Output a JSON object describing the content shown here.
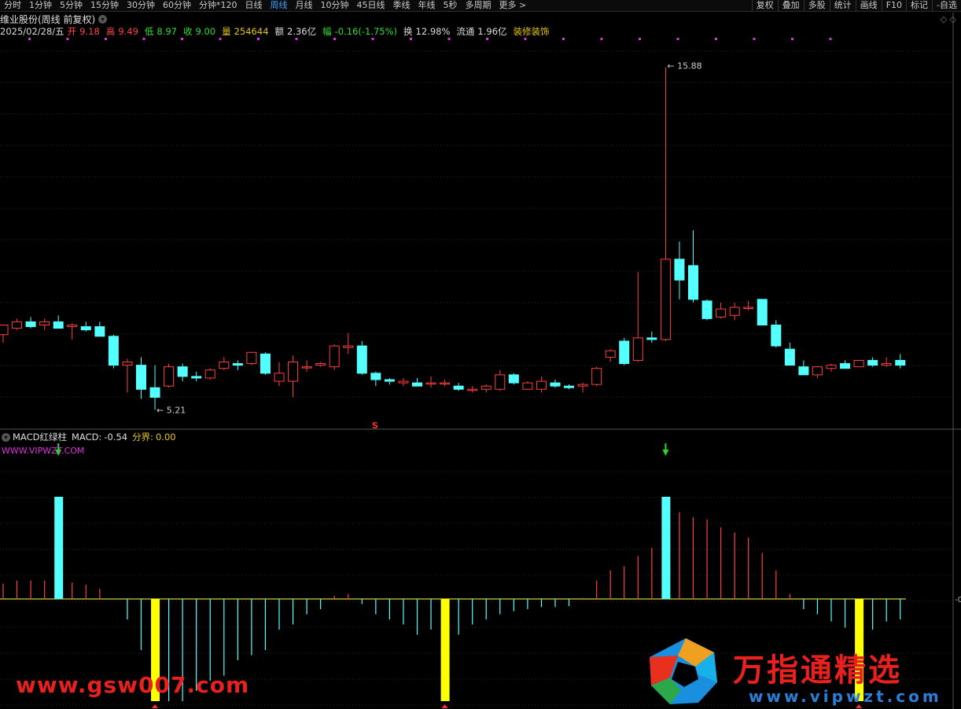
{
  "toolbar": {
    "tabs": [
      "分时",
      "1分钟",
      "5分钟",
      "15分钟",
      "30分钟",
      "60分钟",
      "分钟*120",
      "日线",
      "周线",
      "月线",
      "10分钟",
      "45日线",
      "季线",
      "年线",
      "5秒",
      "多周期",
      "更多 >"
    ],
    "active_tab": "周线",
    "right_buttons": [
      "复权",
      "叠加",
      "多股",
      "统计",
      "画线",
      "F10",
      "标记",
      "-自选"
    ]
  },
  "stock": {
    "title": "维业股份(周线 前复权)",
    "date": "2025/02/28/五",
    "open_label": "开",
    "open": "9.18",
    "high_label": "高",
    "high": "9.49",
    "low_label": "低",
    "low": "8.97",
    "close_label": "收",
    "close": "9.00",
    "volume_label": "量",
    "volume": "254644",
    "amount_label": "额",
    "amount": "2.36亿",
    "change_label": "幅",
    "change": "-0.16(-1.75%)",
    "turnover_label": "换",
    "turnover": "12.98%",
    "float_label": "流通",
    "float": "1.96亿",
    "sector": "装修装饰"
  },
  "price_annotations": {
    "high": "15.88",
    "low": "5.21",
    "signal": "S"
  },
  "macd_panel": {
    "title": "MACD红绿柱",
    "macd_label": "MACD:",
    "macd_value": "-0.54",
    "boundary_label": "分界:",
    "boundary_value": "0.00",
    "watermark": "WWW.VIPWZT.COM",
    "axis_label": "-0"
  },
  "branding": {
    "left_url": "www.gsw007.com",
    "logo_title": "万指通精选",
    "logo_url": "www.vipwzt.com"
  },
  "colors": {
    "up": "#ff4040",
    "down": "#54ffff",
    "macd_pos": "#ff4040",
    "macd_neg": "#54ffff",
    "highlight_yellow": "#ffff00",
    "zero_line": "#ffff55",
    "grid": "#2a2a2a",
    "dots": "#dd33dd"
  },
  "chart_data": {
    "type": "candlestick",
    "price_range": [
      5.0,
      16.5
    ],
    "candles": [
      {
        "o": 7.55,
        "h": 7.85,
        "l": 7.3,
        "c": 7.85
      },
      {
        "o": 7.75,
        "h": 8.05,
        "l": 7.7,
        "c": 7.95
      },
      {
        "o": 7.95,
        "h": 8.1,
        "l": 7.75,
        "c": 7.8
      },
      {
        "o": 7.85,
        "h": 8.05,
        "l": 7.7,
        "c": 7.95
      },
      {
        "o": 7.95,
        "h": 8.15,
        "l": 7.75,
        "c": 7.75
      },
      {
        "o": 7.8,
        "h": 7.9,
        "l": 7.4,
        "c": 7.85
      },
      {
        "o": 7.8,
        "h": 7.95,
        "l": 7.65,
        "c": 7.7
      },
      {
        "o": 7.8,
        "h": 7.95,
        "l": 7.5,
        "c": 7.5
      },
      {
        "o": 7.5,
        "h": 7.55,
        "l": 6.5,
        "c": 6.6
      },
      {
        "o": 6.6,
        "h": 6.8,
        "l": 5.75,
        "c": 6.7
      },
      {
        "o": 6.6,
        "h": 6.85,
        "l": 5.55,
        "c": 5.85
      },
      {
        "o": 5.9,
        "h": 6.6,
        "l": 5.21,
        "c": 5.6
      },
      {
        "o": 5.95,
        "h": 6.65,
        "l": 5.9,
        "c": 6.55
      },
      {
        "o": 6.55,
        "h": 6.65,
        "l": 6.1,
        "c": 6.25
      },
      {
        "o": 6.25,
        "h": 6.4,
        "l": 6.1,
        "c": 6.2
      },
      {
        "o": 6.2,
        "h": 6.5,
        "l": 6.15,
        "c": 6.45
      },
      {
        "o": 6.5,
        "h": 6.85,
        "l": 6.45,
        "c": 6.7
      },
      {
        "o": 6.65,
        "h": 6.75,
        "l": 6.45,
        "c": 6.6
      },
      {
        "o": 6.65,
        "h": 7.0,
        "l": 6.6,
        "c": 7.0
      },
      {
        "o": 6.95,
        "h": 7.0,
        "l": 6.3,
        "c": 6.35
      },
      {
        "o": 6.1,
        "h": 6.7,
        "l": 5.95,
        "c": 6.35
      },
      {
        "o": 6.1,
        "h": 6.9,
        "l": 5.6,
        "c": 6.7
      },
      {
        "o": 6.55,
        "h": 6.75,
        "l": 6.4,
        "c": 6.55
      },
      {
        "o": 6.6,
        "h": 6.7,
        "l": 6.55,
        "c": 6.65
      },
      {
        "o": 6.55,
        "h": 7.25,
        "l": 6.45,
        "c": 7.2
      },
      {
        "o": 7.15,
        "h": 7.6,
        "l": 6.95,
        "c": 7.2
      },
      {
        "o": 7.2,
        "h": 7.35,
        "l": 6.3,
        "c": 6.35
      },
      {
        "o": 6.35,
        "h": 6.4,
        "l": 5.95,
        "c": 6.15
      },
      {
        "o": 6.15,
        "h": 6.2,
        "l": 6.0,
        "c": 6.1
      },
      {
        "o": 6.05,
        "h": 6.2,
        "l": 5.95,
        "c": 6.1
      },
      {
        "o": 6.05,
        "h": 6.2,
        "l": 5.95,
        "c": 5.95
      },
      {
        "o": 6.05,
        "h": 6.25,
        "l": 5.9,
        "c": 6.05
      },
      {
        "o": 6.05,
        "h": 6.15,
        "l": 5.95,
        "c": 6.05
      },
      {
        "o": 5.95,
        "h": 6.05,
        "l": 5.8,
        "c": 5.85
      },
      {
        "o": 5.85,
        "h": 5.95,
        "l": 5.75,
        "c": 5.85
      },
      {
        "o": 5.85,
        "h": 6.0,
        "l": 5.75,
        "c": 5.95
      },
      {
        "o": 5.85,
        "h": 6.45,
        "l": 5.8,
        "c": 6.3
      },
      {
        "o": 6.3,
        "h": 6.35,
        "l": 6.0,
        "c": 6.05
      },
      {
        "o": 5.85,
        "h": 6.1,
        "l": 5.85,
        "c": 6.05
      },
      {
        "o": 5.85,
        "h": 6.25,
        "l": 5.75,
        "c": 6.1
      },
      {
        "o": 6.05,
        "h": 6.15,
        "l": 5.9,
        "c": 5.95
      },
      {
        "o": 5.95,
        "h": 6.0,
        "l": 5.85,
        "c": 5.9
      },
      {
        "o": 5.95,
        "h": 6.05,
        "l": 5.75,
        "c": 6.0
      },
      {
        "o": 6.0,
        "h": 6.55,
        "l": 5.95,
        "c": 6.5
      },
      {
        "o": 6.85,
        "h": 7.1,
        "l": 6.7,
        "c": 7.05
      },
      {
        "o": 7.35,
        "h": 7.45,
        "l": 6.6,
        "c": 6.65
      },
      {
        "o": 6.75,
        "h": 9.5,
        "l": 6.7,
        "c": 7.45
      },
      {
        "o": 7.45,
        "h": 7.65,
        "l": 7.3,
        "c": 7.4
      },
      {
        "o": 7.4,
        "h": 15.88,
        "l": 7.35,
        "c": 9.9
      },
      {
        "o": 9.9,
        "h": 10.45,
        "l": 8.65,
        "c": 9.25
      },
      {
        "o": 9.7,
        "h": 10.8,
        "l": 8.55,
        "c": 8.65
      },
      {
        "o": 8.6,
        "h": 8.65,
        "l": 8.0,
        "c": 8.05
      },
      {
        "o": 8.1,
        "h": 8.55,
        "l": 8.05,
        "c": 8.35
      },
      {
        "o": 8.15,
        "h": 8.55,
        "l": 8.0,
        "c": 8.4
      },
      {
        "o": 8.4,
        "h": 8.6,
        "l": 8.3,
        "c": 8.4
      },
      {
        "o": 8.65,
        "h": 8.65,
        "l": 7.85,
        "c": 7.85
      },
      {
        "o": 7.85,
        "h": 8.0,
        "l": 7.15,
        "c": 7.2
      },
      {
        "o": 7.1,
        "h": 7.3,
        "l": 6.6,
        "c": 6.6
      },
      {
        "o": 6.55,
        "h": 6.75,
        "l": 6.3,
        "c": 6.3
      },
      {
        "o": 6.3,
        "h": 6.55,
        "l": 6.2,
        "c": 6.55
      },
      {
        "o": 6.5,
        "h": 6.65,
        "l": 6.4,
        "c": 6.6
      },
      {
        "o": 6.65,
        "h": 6.75,
        "l": 6.5,
        "c": 6.5
      },
      {
        "o": 6.55,
        "h": 6.75,
        "l": 6.55,
        "c": 6.75
      },
      {
        "o": 6.75,
        "h": 6.85,
        "l": 6.55,
        "c": 6.6
      },
      {
        "o": 6.6,
        "h": 6.85,
        "l": 6.55,
        "c": 6.65
      },
      {
        "o": 6.75,
        "h": 6.95,
        "l": 6.5,
        "c": 6.6
      }
    ],
    "macd": [
      0.15,
      0.18,
      0.18,
      0.18,
      0.8,
      0.16,
      0.14,
      0.1,
      0,
      -0.2,
      -0.5,
      -1.0,
      -1.0,
      -1.0,
      -0.9,
      -0.8,
      -0.75,
      -0.6,
      -0.55,
      -0.5,
      -0.3,
      -0.25,
      -0.15,
      -0.1,
      0.03,
      0.05,
      -0.05,
      -0.15,
      -0.2,
      -0.25,
      -0.35,
      -0.3,
      -1.0,
      -0.35,
      -0.25,
      -0.2,
      -0.15,
      -0.12,
      -0.1,
      -0.08,
      -0.08,
      -0.07,
      0.01,
      0.18,
      0.28,
      0.32,
      0.42,
      0.5,
      0.75,
      0.85,
      0.8,
      0.78,
      0.7,
      0.65,
      0.6,
      0.45,
      0.28,
      0.05,
      -0.1,
      -0.15,
      -0.22,
      -0.28,
      -1.0,
      -0.3,
      -0.22,
      -0.2
    ],
    "macd_highlights": {
      "cyan": [
        4,
        48
      ],
      "yellow": [
        11,
        32,
        62
      ]
    },
    "macd_range": [
      -1.0,
      1.0
    ]
  }
}
